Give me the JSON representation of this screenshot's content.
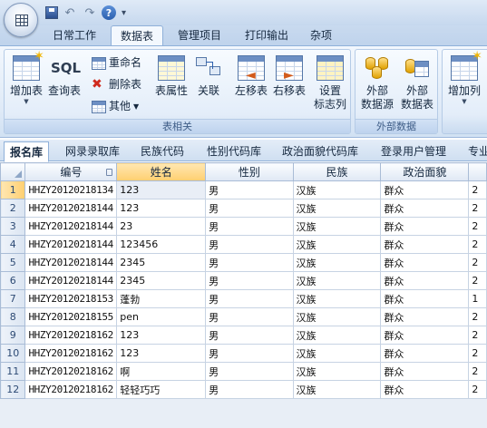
{
  "quick_access": {
    "save": "保存",
    "undo": "撤销",
    "redo": "恢复",
    "help": "?"
  },
  "ribbon_tabs": [
    {
      "label": "日常工作",
      "active": false
    },
    {
      "label": "数据表",
      "active": true
    },
    {
      "label": "管理项目",
      "active": false
    },
    {
      "label": "打印输出",
      "active": false
    },
    {
      "label": "杂项",
      "active": false
    }
  ],
  "ribbon": {
    "groups": [
      {
        "label": "表相关"
      },
      {
        "label": "外部数据"
      }
    ],
    "buttons": {
      "add_table": "增加表",
      "query_table": "查询表",
      "rename": "重命名",
      "delete_table": "删除表",
      "other": "其他",
      "table_properties": "表属性",
      "relations": "关联",
      "move_left": "左移表",
      "move_right": "右移表",
      "set_title_col_1": "设置",
      "set_title_col_2": "标志列",
      "ext_source_1": "外部",
      "ext_source_2": "数据源",
      "ext_table_1": "外部",
      "ext_table_2": "数据表",
      "add_column": "增加列"
    },
    "sql_text": "SQL"
  },
  "sub_tabs": [
    {
      "label": "报名库",
      "active": true
    },
    {
      "label": "网录录取库",
      "active": false
    },
    {
      "label": "民族代码",
      "active": false
    },
    {
      "label": "性别代码库",
      "active": false
    },
    {
      "label": "政治面貌代码库",
      "active": false
    },
    {
      "label": "登录用户管理",
      "active": false
    },
    {
      "label": "专业",
      "active": false
    }
  ],
  "grid": {
    "columns": [
      "编号",
      "姓名",
      "性别",
      "民族",
      "政治面貌"
    ],
    "rows": [
      {
        "n": "1",
        "id": "HHZY20120218134",
        "name": "123",
        "sex": "男",
        "nation": "汉族",
        "politics": "群众",
        "extra": "2"
      },
      {
        "n": "2",
        "id": "HHZY20120218144",
        "name": "123",
        "sex": "男",
        "nation": "汉族",
        "politics": "群众",
        "extra": "2"
      },
      {
        "n": "3",
        "id": "HHZY20120218144",
        "name": "23",
        "sex": "男",
        "nation": "汉族",
        "politics": "群众",
        "extra": "2"
      },
      {
        "n": "4",
        "id": "HHZY20120218144",
        "name": "123456",
        "sex": "男",
        "nation": "汉族",
        "politics": "群众",
        "extra": "2"
      },
      {
        "n": "5",
        "id": "HHZY20120218144",
        "name": "2345",
        "sex": "男",
        "nation": "汉族",
        "politics": "群众",
        "extra": "2"
      },
      {
        "n": "6",
        "id": "HHZY20120218144",
        "name": "2345",
        "sex": "男",
        "nation": "汉族",
        "politics": "群众",
        "extra": "2"
      },
      {
        "n": "7",
        "id": "HHZY20120218153",
        "name": "蓬勃",
        "sex": "男",
        "nation": "汉族",
        "politics": "群众",
        "extra": "1"
      },
      {
        "n": "8",
        "id": "HHZY20120218155",
        "name": "pen",
        "sex": "男",
        "nation": "汉族",
        "politics": "群众",
        "extra": "2"
      },
      {
        "n": "9",
        "id": "HHZY20120218162",
        "name": "123",
        "sex": "男",
        "nation": "汉族",
        "politics": "群众",
        "extra": "2"
      },
      {
        "n": "10",
        "id": "HHZY20120218162",
        "name": "123",
        "sex": "男",
        "nation": "汉族",
        "politics": "群众",
        "extra": "2"
      },
      {
        "n": "11",
        "id": "HHZY20120218162",
        "name": "啊",
        "sex": "男",
        "nation": "汉族",
        "politics": "群众",
        "extra": "2"
      },
      {
        "n": "12",
        "id": "HHZY20120218162",
        "name": "轻轻巧巧",
        "sex": "男",
        "nation": "汉族",
        "politics": "群众",
        "extra": "2"
      }
    ]
  },
  "colors": {
    "ribbon_blue": "#dfeaf7",
    "selected_header": "#ffcf70",
    "border": "#8fb0d9"
  }
}
